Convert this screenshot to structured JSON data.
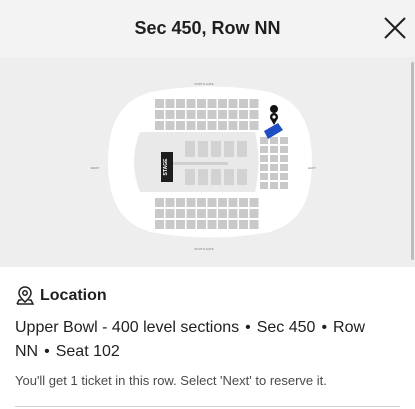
{
  "header": {
    "title": "Sec 450, Row NN"
  },
  "icons": {
    "close": "close-icon",
    "location": "map-pin-icon",
    "seat_marker": "map-pin-icon"
  },
  "colors": {
    "selected_section": "#1f4fc2",
    "section_fill": "#c9c9c9",
    "map_bg": "#eeeeee"
  },
  "map": {
    "stage_label": "STAGE",
    "labels": {
      "top": "NORTH GATE",
      "bottom": "SOUTH GATE",
      "left": "WEST",
      "right": "EAST"
    },
    "selected_section": "450"
  },
  "location": {
    "heading": "Location",
    "level": "Upper Bowl - 400 level sections",
    "section": "Sec 450",
    "row": "Row NN",
    "seat": "Seat 102",
    "separator": "•",
    "note": "You'll get 1 ticket in this row. Select 'Next' to reserve it."
  }
}
